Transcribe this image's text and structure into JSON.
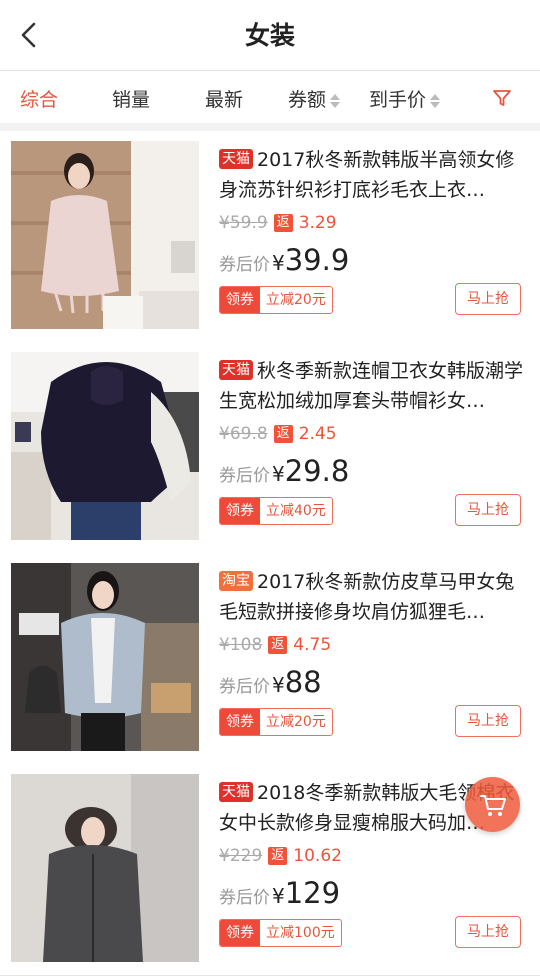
{
  "header": {
    "title": "女装"
  },
  "tabs": {
    "comprehensive": "综合",
    "sales": "销量",
    "newest": "最新",
    "coupon_amount": "券额",
    "final_price": "到手价"
  },
  "products": [
    {
      "platform": "天猫",
      "title": "2017秋冬新款韩版半高领女修身流苏针织衫打底衫毛衣上衣…",
      "original_price": "¥59.9",
      "rebate_label": "返",
      "rebate": "3.29",
      "after_label": "券后价",
      "currency": "¥",
      "price": "39.9",
      "coupon_label": "领券",
      "coupon_value": "立减20元",
      "buy_label": "马上抢"
    },
    {
      "platform": "天猫",
      "title": "秋冬季新款连帽卫衣女韩版潮学生宽松加绒加厚套头带帽衫女…",
      "original_price": "¥69.8",
      "rebate_label": "返",
      "rebate": "2.45",
      "after_label": "券后价",
      "currency": "¥",
      "price": "29.8",
      "coupon_label": "领券",
      "coupon_value": "立减40元",
      "buy_label": "马上抢"
    },
    {
      "platform": "淘宝",
      "title": "2017秋冬新款仿皮草马甲女兔毛短款拼接修身坎肩仿狐狸毛…",
      "original_price": "¥108",
      "rebate_label": "返",
      "rebate": "4.75",
      "after_label": "券后价",
      "currency": "¥",
      "price": "88",
      "coupon_label": "领券",
      "coupon_value": "立减20元",
      "buy_label": "马上抢"
    },
    {
      "platform": "天猫",
      "title": "2018冬季新款韩版大毛领棉衣女中长款修身显瘦棉服大码加…",
      "original_price": "¥229",
      "rebate_label": "返",
      "rebate": "10.62",
      "after_label": "券后价",
      "currency": "¥",
      "price": "129",
      "coupon_label": "领券",
      "coupon_value": "立减100元",
      "buy_label": "马上抢"
    }
  ],
  "colors": {
    "accent": "#e4573d",
    "tmall": "#e0302a",
    "taobao": "#f0703a"
  },
  "icons": {
    "back": "chevron-left-icon",
    "filter": "filter-icon",
    "cart": "cart-icon"
  }
}
